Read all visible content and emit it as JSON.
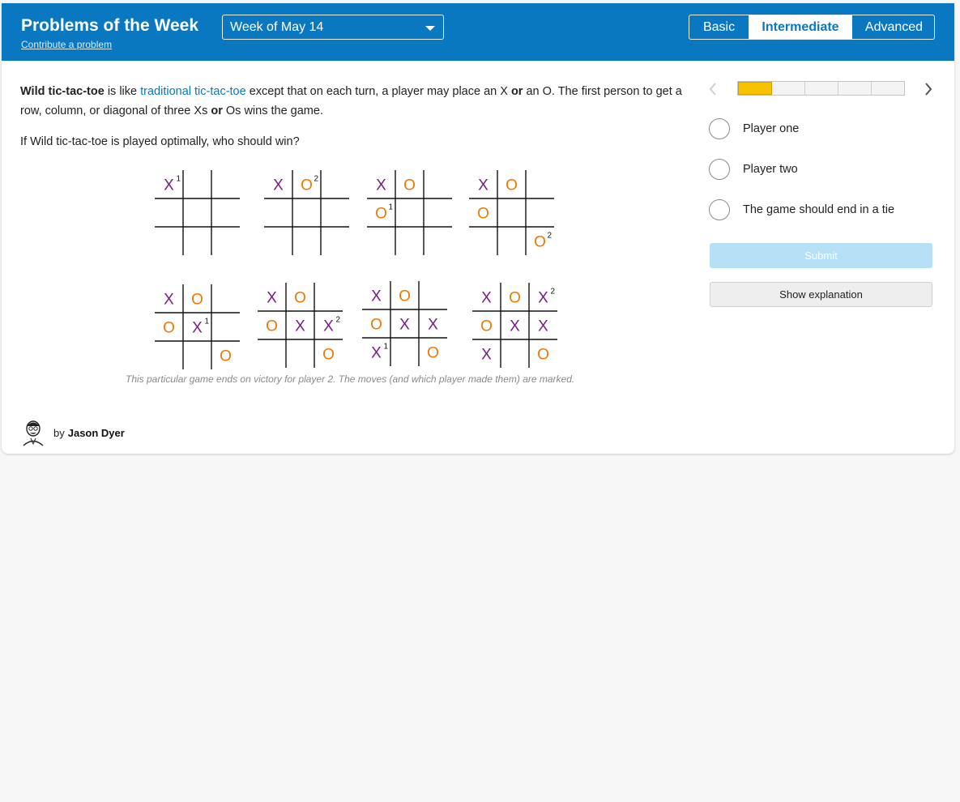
{
  "header": {
    "title": "Problems of the Week",
    "contribute_link": "Contribute a problem",
    "week_select": "Week of May 14",
    "levels": {
      "basic": "Basic",
      "intermediate": "Intermediate",
      "advanced": "Advanced"
    },
    "selected_level": "Intermediate",
    "colors": {
      "bar": "#0a78c0"
    }
  },
  "problem": {
    "term": "Wild tic-tac-toe",
    "text_1": " is like ",
    "link": "traditional tic-tac-toe",
    "text_2": " except that on each turn, a player may place an X ",
    "or_1": "or",
    "text_3": " an O. The first person to get a row, column, or diagonal of three Xs ",
    "or_2": "or",
    "text_4": " Os wins the game.",
    "question": "If Wild tic-tac-toe is played optimally, who should win?"
  },
  "figure": {
    "caption": "This particular game ends on victory for player 2. The moves (and which player made them) are marked.",
    "colors": {
      "x": "#7a1e86",
      "o": "#f07800"
    },
    "boards": [
      {
        "cells": [
          "X1",
          "",
          "",
          "",
          "",
          "",
          "",
          "",
          ""
        ]
      },
      {
        "cells": [
          "X",
          "O2",
          "",
          "",
          "",
          "",
          "",
          "",
          ""
        ]
      },
      {
        "cells": [
          "X",
          "O",
          "",
          "O1",
          "",
          "",
          "",
          "",
          ""
        ]
      },
      {
        "cells": [
          "X",
          "O",
          "",
          "O",
          "",
          "",
          "",
          "",
          "O2"
        ]
      },
      {
        "cells": [
          "X",
          "O",
          "",
          "O",
          "X1",
          "",
          "",
          "",
          "O"
        ]
      },
      {
        "cells": [
          "X",
          "O",
          "",
          "O",
          "X",
          "X2",
          "",
          "",
          "O"
        ]
      },
      {
        "cells": [
          "X",
          "O",
          "",
          "O",
          "X",
          "X",
          "X1",
          "",
          "O"
        ]
      },
      {
        "cells": [
          "X",
          "O",
          "X2",
          "O",
          "X",
          "X",
          "X",
          "",
          "O"
        ]
      }
    ]
  },
  "author": {
    "by": "by",
    "name": "Jason Dyer"
  },
  "sidebar": {
    "progress": {
      "completed": 1,
      "total": 5
    },
    "choices": [
      "Player one",
      "Player two",
      "The game should end in a tie"
    ],
    "submit": "Submit",
    "show_explanation": "Show explanation",
    "colors": {
      "progress_fill": "#f7c300",
      "submit_bg": "#b5e0f6"
    }
  }
}
